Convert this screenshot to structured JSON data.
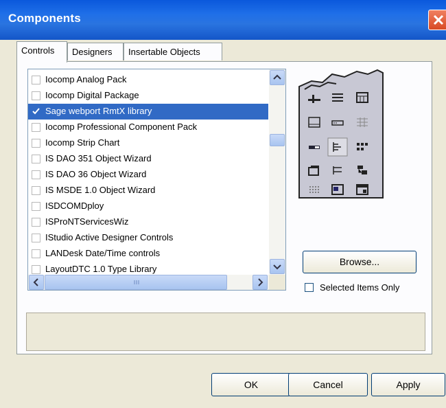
{
  "window": {
    "title": "Components"
  },
  "tabs": [
    {
      "label": "Controls"
    },
    {
      "label": "Designers"
    },
    {
      "label": "Insertable Objects"
    }
  ],
  "list": {
    "items": [
      {
        "label": "Iocomp Analog Pack",
        "checked": false,
        "selected": false
      },
      {
        "label": "Iocomp Digital Package",
        "checked": false,
        "selected": false
      },
      {
        "label": "Sage webport RmtX library",
        "checked": true,
        "selected": true
      },
      {
        "label": "Iocomp Professional Component Pack",
        "checked": false,
        "selected": false
      },
      {
        "label": "Iocomp Strip Chart",
        "checked": false,
        "selected": false
      },
      {
        "label": "IS DAO 351 Object Wizard",
        "checked": false,
        "selected": false
      },
      {
        "label": "IS DAO 36 Object Wizard",
        "checked": false,
        "selected": false
      },
      {
        "label": "IS MSDE 1.0 Object Wizard",
        "checked": false,
        "selected": false
      },
      {
        "label": "ISDCOMDploy",
        "checked": false,
        "selected": false
      },
      {
        "label": "ISProNTServicesWiz",
        "checked": false,
        "selected": false
      },
      {
        "label": "IStudio Active Designer Controls",
        "checked": false,
        "selected": false
      },
      {
        "label": "LANDesk Date/Time controls",
        "checked": false,
        "selected": false
      },
      {
        "label": "LayoutDTC 1.0 Type Library",
        "checked": false,
        "selected": false
      }
    ]
  },
  "palette_icons": [
    "slider-icon",
    "text-lines-icon",
    "calendar-grid-icon",
    "frame-icon",
    "textbox-icon",
    "grid-icon",
    "progress-bar-icon",
    "treeview-icon",
    "listview-icon",
    "tabstrip-icon",
    "toolbar-icon",
    "hierarchy-icon",
    "dotted-grid-icon",
    "image-list-icon",
    "status-bar-icon"
  ],
  "actions": {
    "browse_label": "Browse...",
    "selected_only_label": "Selected Items Only",
    "ok_label": "OK",
    "cancel_label": "Cancel",
    "apply_label": "Apply"
  },
  "colors": {
    "titlebar": "#0a58dc",
    "selection": "#316ac5",
    "dialog_bg": "#ece9d8"
  }
}
